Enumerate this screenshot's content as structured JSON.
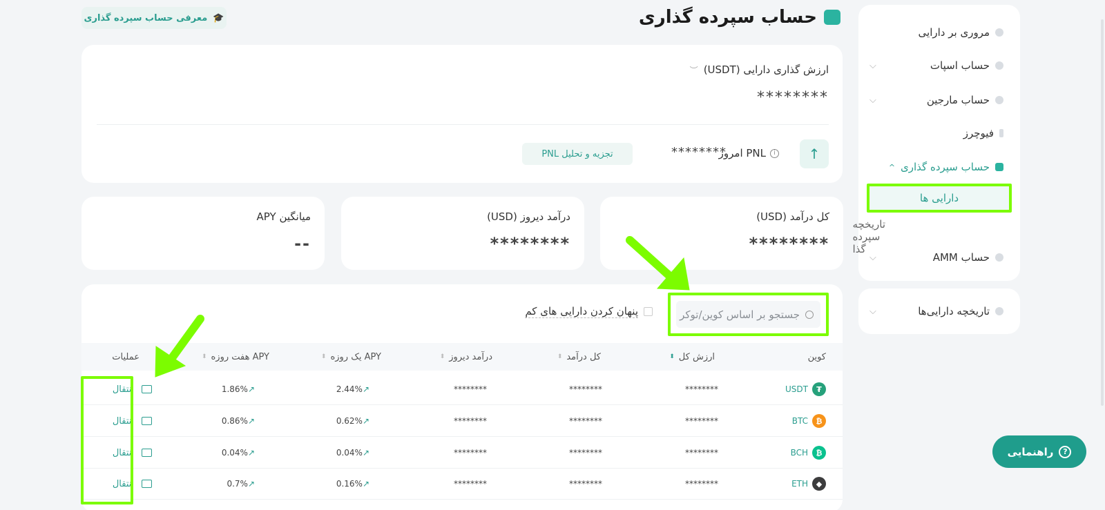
{
  "page": {
    "title": "حساب سپرده گذاری",
    "intro_button": "معرفی حساب سپرده گذاری"
  },
  "sidebar": {
    "items": [
      {
        "label": "مروری بر دارایی"
      },
      {
        "label": "حساب اسپات"
      },
      {
        "label": "حساب مارجین"
      },
      {
        "label": "فیوچرز"
      },
      {
        "label": "حساب سپرده گذاری"
      },
      {
        "label": "حساب AMM"
      }
    ],
    "sub_items": [
      {
        "label": "دارایی ها"
      },
      {
        "label": "تاریخچه سپرده گذا"
      }
    ],
    "history": "تاریخچه دارایی‌ها"
  },
  "value_card": {
    "label": "ارزش گذاری دارایی (USDT)",
    "value": "********",
    "pnl_label": "PNL امروز",
    "pnl_value": "********",
    "pnl_button": "تجزیه و تحلیل PNL"
  },
  "stats": [
    {
      "label": "کل درآمد (USD)",
      "value": "********"
    },
    {
      "label": "درآمد دیروز (USD)",
      "value": "********"
    },
    {
      "label": "میانگین APY",
      "value": "--"
    }
  ],
  "table": {
    "search_placeholder": "جستجو بر اساس کوین/توکر",
    "hide_small_label": "پنهان کردن دارایی های کم",
    "headers": {
      "coin": "کوین",
      "total_value": "ارزش کل",
      "total_income": "کل درآمد",
      "yesterday_income": "درآمد دیروز",
      "apy_1d": "APY یک روزه",
      "apy_7d": "APY هفت روزه",
      "operations": "عملیات"
    },
    "rows": [
      {
        "coin": "USDT",
        "coin_color": "#26a17b",
        "coin_glyph": "₮",
        "total_value": "********",
        "total_income": "********",
        "yesterday_income": "********",
        "apy_1d": "2.44%",
        "apy_7d": "1.86%",
        "action": "انتقال"
      },
      {
        "coin": "BTC",
        "coin_color": "#f7931a",
        "coin_glyph": "₿",
        "total_value": "********",
        "total_income": "********",
        "yesterday_income": "********",
        "apy_1d": "0.62%",
        "apy_7d": "0.86%",
        "action": "انتقال"
      },
      {
        "coin": "BCH",
        "coin_color": "#0ac18e",
        "coin_glyph": "₿",
        "total_value": "********",
        "total_income": "********",
        "yesterday_income": "********",
        "apy_1d": "0.04%",
        "apy_7d": "0.04%",
        "action": "انتقال"
      },
      {
        "coin": "ETH",
        "coin_color": "#3c3c3d",
        "coin_glyph": "◆",
        "total_value": "********",
        "total_income": "********",
        "yesterday_income": "********",
        "apy_1d": "0.16%",
        "apy_7d": "0.7%",
        "action": "انتقال"
      }
    ]
  },
  "help_button": "راهنمایی",
  "colors": {
    "accent": "#2a9d8f",
    "highlight": "#7cfc00"
  }
}
